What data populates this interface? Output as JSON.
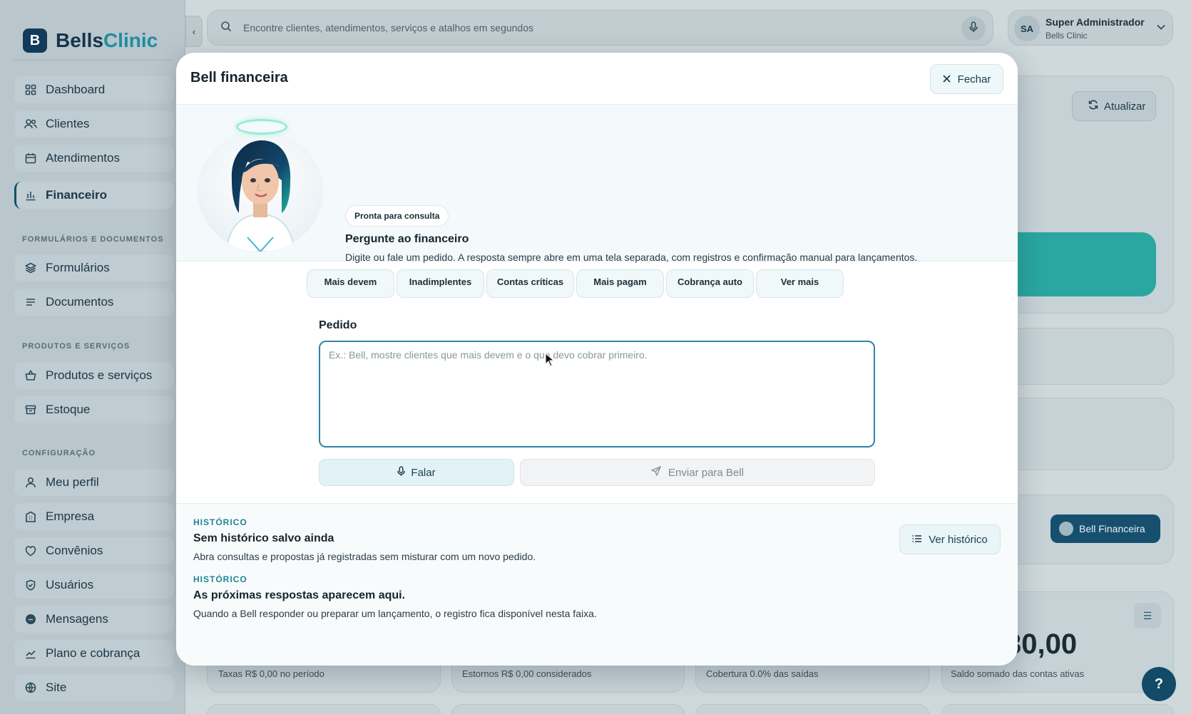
{
  "brand": {
    "logo_letter": "B",
    "name_part1": "Bells",
    "name_part2": "Clinic"
  },
  "sidebar": {
    "items": [
      {
        "label": "Dashboard",
        "icon": "grid-icon"
      },
      {
        "label": "Clientes",
        "icon": "users-icon"
      },
      {
        "label": "Atendimentos",
        "icon": "calendar-icon"
      },
      {
        "label": "Financeiro",
        "icon": "chart-icon"
      },
      {
        "label": "Formulários",
        "icon": "layers-icon"
      },
      {
        "label": "Documentos",
        "icon": "lines-icon"
      },
      {
        "label": "Produtos e serviços",
        "icon": "basket-icon"
      },
      {
        "label": "Estoque",
        "icon": "box-icon"
      },
      {
        "label": "Meu perfil",
        "icon": "user-icon"
      },
      {
        "label": "Empresa",
        "icon": "building-icon"
      },
      {
        "label": "Convênios",
        "icon": "heart-shield-icon"
      },
      {
        "label": "Usuários",
        "icon": "shield-icon"
      },
      {
        "label": "Mensagens",
        "icon": "chat-icon"
      },
      {
        "label": "Plano e cobrança",
        "icon": "trend-icon"
      },
      {
        "label": "Site",
        "icon": "globe-icon"
      }
    ],
    "sections": [
      "FORMULÁRIOS E DOCUMENTOS",
      "PRODUTOS E SERVIÇOS",
      "CONFIGURAÇÃO"
    ]
  },
  "topbar": {
    "collapse_glyph": "‹",
    "search_placeholder": "Encontre clientes, atendimentos, serviços e atalhos em segundos",
    "user_initials": "SA",
    "user_name": "Super Administrador",
    "user_company": "Bells Clinic"
  },
  "background": {
    "refresh_label": "Atualizar",
    "bell_button": "Bell Financeira",
    "big_value": "30,00",
    "captions": [
      "Taxas R$ 0,00 no período",
      "Estornos R$ 0,00 considerados",
      "Cobertura 0.0% das saídas",
      "Saldo somado das contas ativas"
    ],
    "help_label": "?"
  },
  "modal": {
    "title": "Bell financeira",
    "close_label": "Fechar",
    "status_badge": "Pronta para consulta",
    "heading": "Pergunte ao financeiro",
    "description": "Digite ou fale um pedido. A resposta sempre abre em uma tela separada, com registros e confirmação manual para lançamentos.",
    "chips": [
      "Mais devem",
      "Inadimplentes",
      "Contas críticas",
      "Mais pagam",
      "Cobrança auto",
      "Ver mais"
    ],
    "field_label": "Pedido",
    "textarea_placeholder": "Ex.: Bell, mostre clientes que mais devem e o que devo cobrar primeiro.",
    "speak_label": "Falar",
    "send_label": "Enviar para Bell",
    "history": [
      {
        "label": "HISTÓRICO",
        "title": "Sem histórico salvo ainda",
        "text": "Abra consultas e propostas já registradas sem misturar com um novo pedido."
      },
      {
        "label": "HISTÓRICO",
        "title": "As próximas respostas aparecem aqui.",
        "text": "Quando a Bell responder ou preparar um lançamento, o registro fica disponível nesta faixa."
      }
    ],
    "history_button": "Ver histórico"
  },
  "colors": {
    "accent": "#2d86a8",
    "brand_dark": "#134a68",
    "teal": "#2aa7a0",
    "section_label": "#1d8794"
  }
}
